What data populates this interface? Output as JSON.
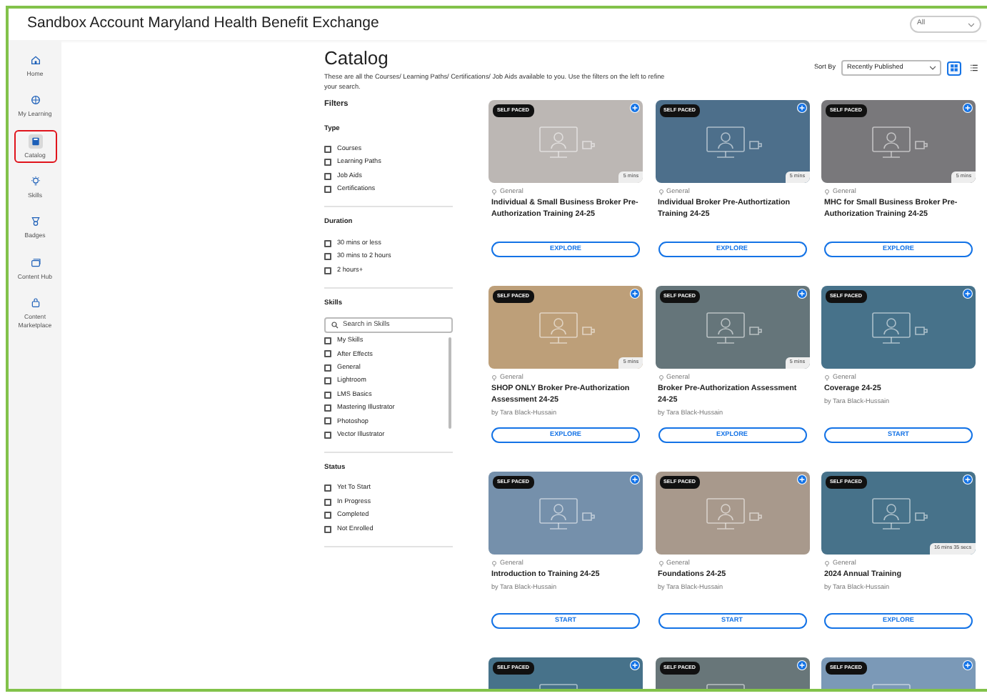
{
  "header": {
    "title": "Sandbox Account Maryland Health Benefit Exchange",
    "scope": "All"
  },
  "sidebar": {
    "items": [
      {
        "label": "Home",
        "kind": "home",
        "selected": false
      },
      {
        "label": "My Learning",
        "kind": "learning",
        "selected": false
      },
      {
        "label": "Catalog",
        "kind": "catalog",
        "selected": true
      },
      {
        "label": "Skills",
        "kind": "skills",
        "selected": false
      },
      {
        "label": "Badges",
        "kind": "badges",
        "selected": false
      },
      {
        "label": "Content Hub",
        "kind": "hub",
        "selected": false
      },
      {
        "label": "Content Marketplace",
        "kind": "market",
        "selected": false
      }
    ]
  },
  "catalog": {
    "title": "Catalog",
    "description": "These are all the Courses/ Learning Paths/ Certifications/ Job Aids available to you. Use the filters on the left to refine your search.",
    "sort_label": "Sort By",
    "sort_value": "Recently Published",
    "views": [
      {
        "kind": "grid",
        "selected": true
      },
      {
        "kind": "list",
        "selected": false
      }
    ]
  },
  "filters": {
    "title": "Filters",
    "groups": [
      {
        "title": "Type",
        "options": [
          {
            "label": "Courses",
            "checked": false
          },
          {
            "label": "Learning Paths",
            "checked": false
          },
          {
            "label": "Job Aids",
            "checked": false
          },
          {
            "label": "Certifications",
            "checked": false
          }
        ]
      },
      {
        "title": "Duration",
        "options": [
          {
            "label": "30 mins or less",
            "checked": false
          },
          {
            "label": "30 mins to 2 hours",
            "checked": false
          },
          {
            "label": "2 hours+",
            "checked": false
          }
        ]
      },
      {
        "title": "Skills",
        "search_placeholder": "Search in Skills",
        "options": [
          {
            "label": "My Skills",
            "checked": false
          },
          {
            "label": "After Effects",
            "checked": false
          },
          {
            "label": "General",
            "checked": false
          },
          {
            "label": "Lightroom",
            "checked": false
          },
          {
            "label": "LMS Basics",
            "checked": false
          },
          {
            "label": "Mastering Illustrator",
            "checked": false
          },
          {
            "label": "Photoshop",
            "checked": false
          },
          {
            "label": "Vector Illustrator",
            "checked": false
          }
        ]
      },
      {
        "title": "Status",
        "options": [
          {
            "label": "Yet To Start",
            "checked": false
          },
          {
            "label": "In Progress",
            "checked": false
          },
          {
            "label": "Completed",
            "checked": false
          },
          {
            "label": "Not Enrolled",
            "checked": false
          }
        ]
      }
    ]
  },
  "cards": [
    {
      "badge": "SELF PACED",
      "color": "#bcb7b4",
      "duration": "5 mins",
      "category": "General",
      "title": "Individual & Small Business Broker Pre-Authorization Training 24-25",
      "button": "EXPLORE"
    },
    {
      "badge": "SELF PACED",
      "color": "#4d6f8b",
      "duration": "5 mins",
      "category": "General",
      "title": "Individual Broker Pre-Authortization Training 24-25",
      "button": "EXPLORE"
    },
    {
      "badge": "SELF PACED",
      "color": "#79787b",
      "duration": "5 mins",
      "category": "General",
      "title": "MHC for Small Business Broker Pre-Authorization Training 24-25",
      "button": "EXPLORE"
    },
    {
      "badge": "SELF PACED",
      "color": "#bd9f79",
      "duration": "5 mins",
      "category": "General",
      "title": "SHOP ONLY Broker Pre-Authorization Assessment 24-25",
      "author": "by Tara Black-Hussain",
      "button": "EXPLORE"
    },
    {
      "badge": "SELF PACED",
      "color": "#65757a",
      "duration": "5 mins",
      "category": "General",
      "title": "Broker Pre-Authorization Assessment 24-25",
      "author": "by Tara Black-Hussain",
      "button": "EXPLORE"
    },
    {
      "badge": "SELF PACED",
      "color": "#47728a",
      "category": "General",
      "title": "Coverage 24-25",
      "author": "by Tara Black-Hussain",
      "button": "START"
    },
    {
      "badge": "SELF PACED",
      "color": "#7590ab",
      "category": "General",
      "title": "Introduction to Training 24-25",
      "author": "by Tara Black-Hussain",
      "button": "START"
    },
    {
      "badge": "SELF PACED",
      "color": "#a8998c",
      "category": "General",
      "title": "Foundations 24-25",
      "author": "by Tara Black-Hussain",
      "button": "START"
    },
    {
      "badge": "SELF PACED",
      "color": "#47728a",
      "duration": "16 mins 35 secs",
      "category": "General",
      "title": "2024 Annual Training",
      "author": "by Tara Black-Hussain",
      "button": "EXPLORE"
    },
    {
      "badge": "SELF PACED",
      "color": "#47728a"
    },
    {
      "badge": "SELF PACED",
      "color": "#687679"
    },
    {
      "badge": "SELF PACED",
      "color": "#7b99b7"
    }
  ]
}
